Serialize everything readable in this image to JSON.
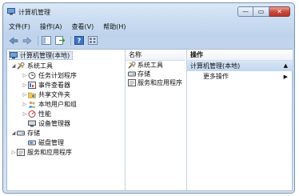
{
  "window": {
    "title": "计算机管理"
  },
  "menu": [
    "文件(F)",
    "操作(A)",
    "查看(V)",
    "帮助(H)"
  ],
  "window_buttons": {
    "minimize": "—",
    "maximize": "▭",
    "close": "✕"
  },
  "tree": {
    "root": "计算机管理(本地)",
    "system_tools": "系统工具",
    "task_scheduler": "任务计划程序",
    "event_viewer": "事件查看器",
    "shared_folders": "共享文件夹",
    "local_users": "本地用户和组",
    "performance": "性能",
    "device_manager": "设备管理器",
    "storage": "存储",
    "disk_management": "磁盘管理",
    "services_apps": "服务和应用程序"
  },
  "list": {
    "header": "名称",
    "items": [
      "系统工具",
      "存储",
      "服务和应用程序"
    ]
  },
  "actions": {
    "header": "操作",
    "section": "计算机管理(本地)",
    "more": "更多操作"
  },
  "colors": {
    "accent": "#2f6fc0",
    "selection": "#dfe9f6",
    "chrome": "#c9dcf1"
  }
}
